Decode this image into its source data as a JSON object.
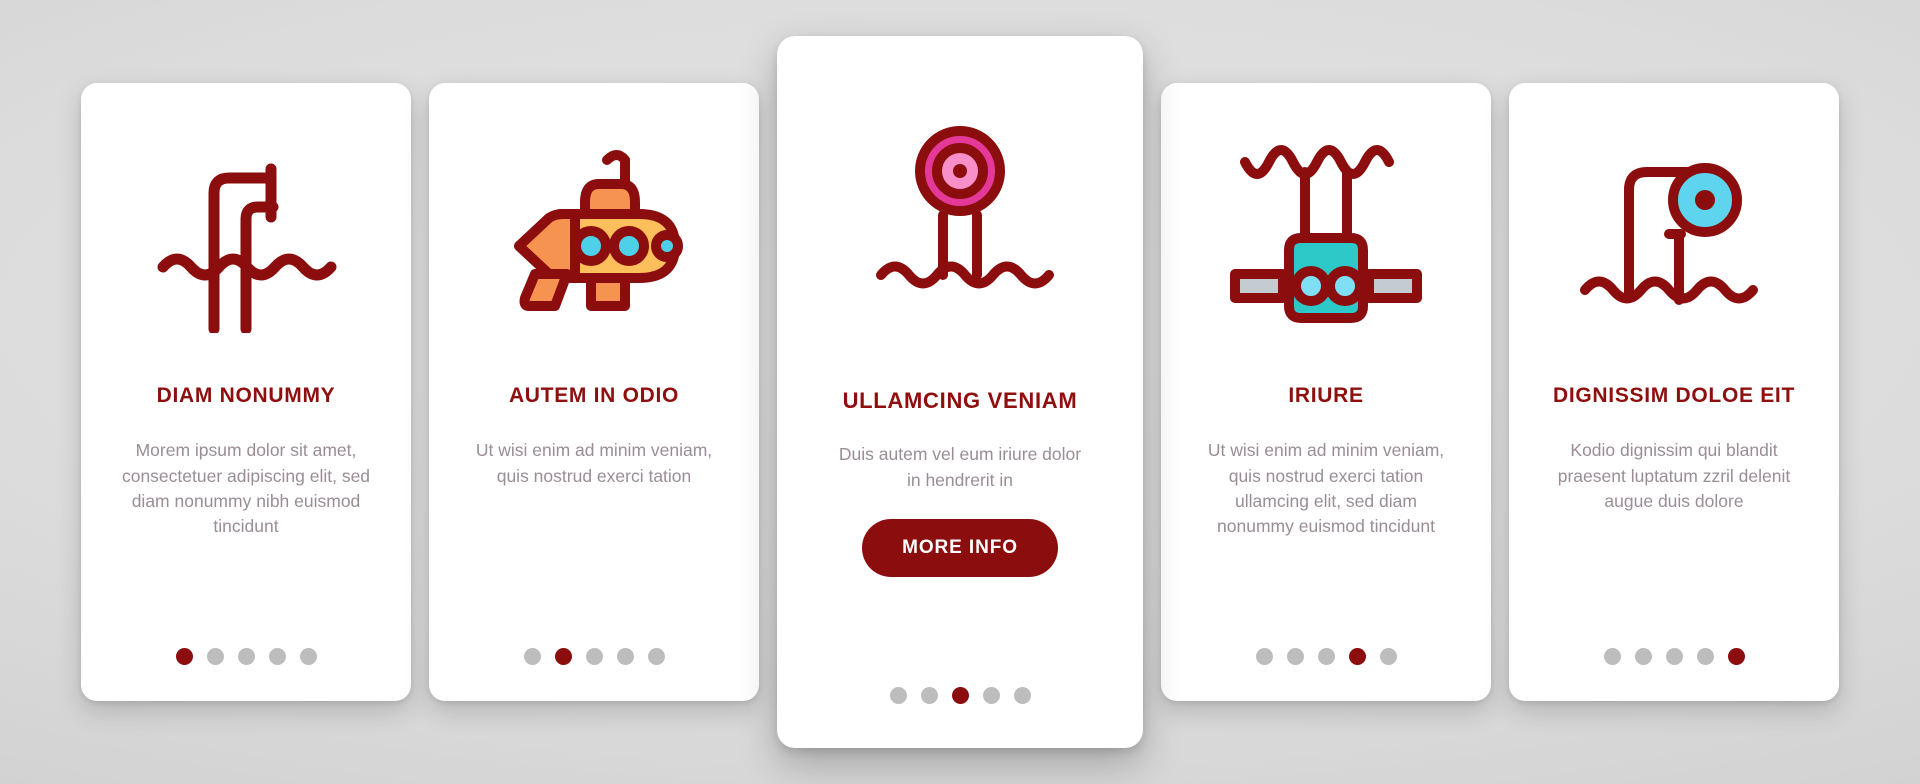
{
  "theme": {
    "accent_red": "#8c0d0d",
    "title_red": "#8f0e0e",
    "body_text": "#9a8d97",
    "dot_inactive": "#bdbdbd",
    "card_bg": "#ffffff",
    "page_bg": "#d9d9d9",
    "sub_orange": "#fcbf5c",
    "sub_orange_dark": "#f79350",
    "porthole_cyan": "#4dd0e8",
    "buoy_magenta": "#e5399a",
    "buoy_pink": "#f98fc8",
    "rov_teal": "#2dc9c9",
    "rov_gray": "#c4ccd2",
    "lens_cyan": "#5fd4ef"
  },
  "cards": [
    {
      "icon_name": "periscope-above-water-icon",
      "title": "DIAM NONUMMY",
      "body": "Morem ipsum dolor sit amet, consectetuer adipiscing elit, sed diam nonummy nibh euismod tincidunt",
      "dots": {
        "count": 5,
        "active_index": 0
      },
      "has_button": false,
      "featured": false
    },
    {
      "icon_name": "submarine-icon",
      "title": "AUTEM IN ODIO",
      "body": "Ut wisi enim ad minim veniam, quis nostrud exerci tation",
      "dots": {
        "count": 5,
        "active_index": 1
      },
      "has_button": false,
      "featured": false
    },
    {
      "icon_name": "marker-buoy-icon",
      "title": "ULLAMCING VENIAM",
      "body": "Duis autem vel eum iriure dolor in hendrerit in",
      "button_label": "MORE INFO",
      "dots": {
        "count": 5,
        "active_index": 2
      },
      "has_button": true,
      "featured": true
    },
    {
      "icon_name": "underwater-rov-icon",
      "title": "IRIURE",
      "body": "Ut wisi enim ad minim veniam, quis nostrud exerci tation ullamcing elit, sed diam nonummy euismod tincidunt",
      "dots": {
        "count": 5,
        "active_index": 3
      },
      "has_button": false,
      "featured": false
    },
    {
      "icon_name": "periscope-lens-icon",
      "title": "DIGNISSIM DOLOE EIT",
      "body": "Kodio dignissim qui blandit praesent luptatum zzril delenit augue duis dolore",
      "dots": {
        "count": 5,
        "active_index": 4
      },
      "has_button": false,
      "featured": false
    }
  ]
}
